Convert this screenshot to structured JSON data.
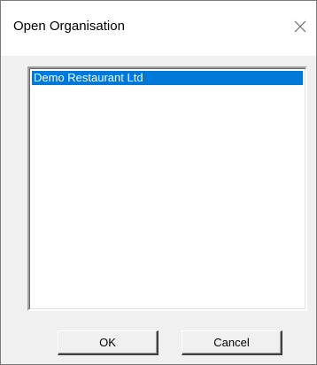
{
  "window": {
    "title": "Open Organisation",
    "close_icon": "close-icon"
  },
  "organisation_list": {
    "items": [
      {
        "label": "Demo Restaurant Ltd",
        "selected": true
      }
    ],
    "selection_color": "#0078d7"
  },
  "buttons": {
    "ok_label": "OK",
    "cancel_label": "Cancel"
  }
}
